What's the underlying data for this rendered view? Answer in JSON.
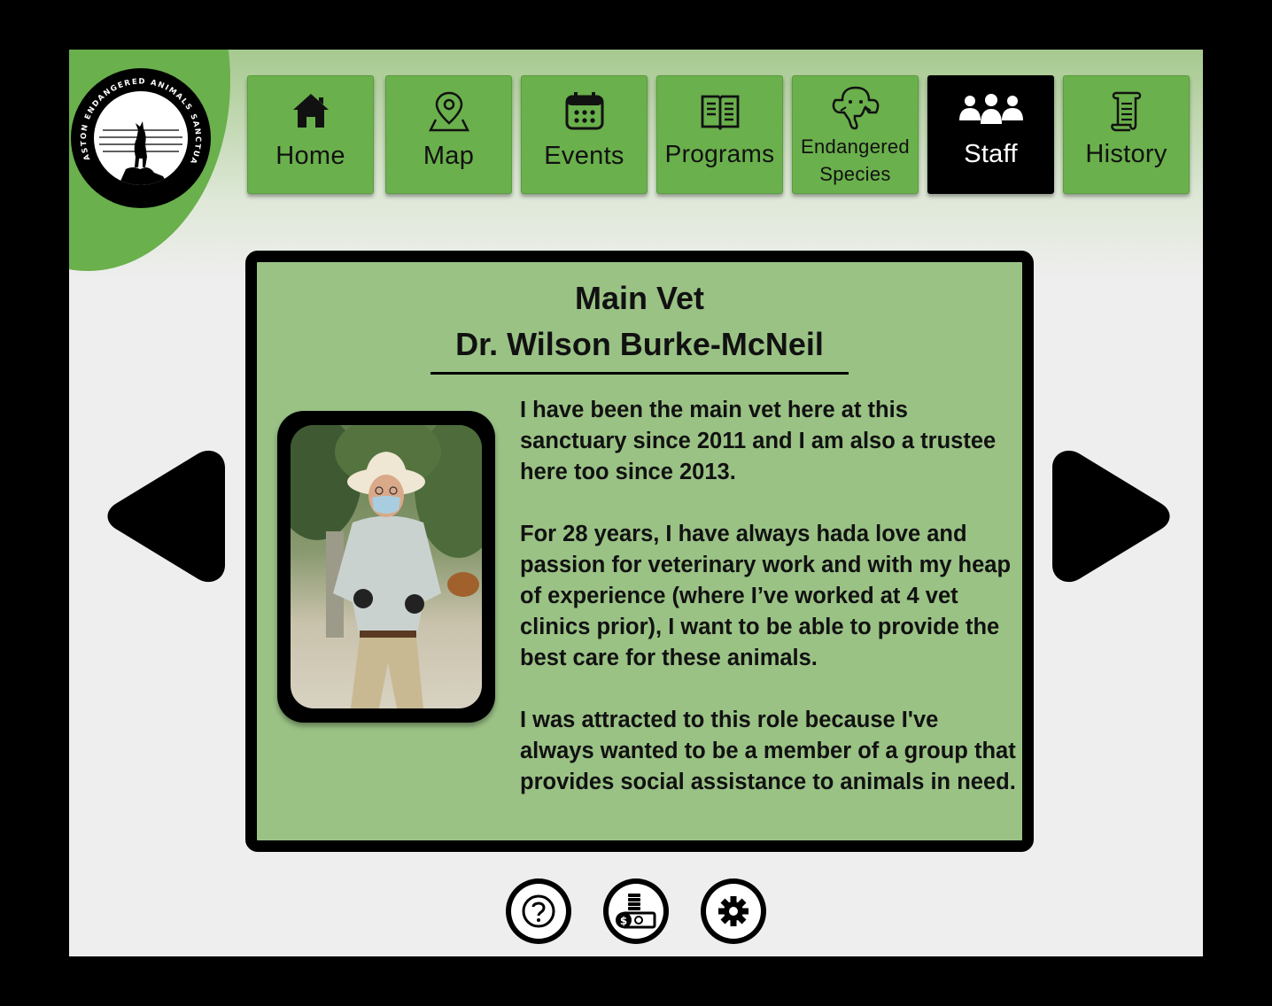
{
  "logo": {
    "text": "ASTON ENDANGERED ANIMALS SANCTUARY"
  },
  "nav": [
    {
      "label": "Home",
      "icon": "home-icon"
    },
    {
      "label": "Map",
      "icon": "map-pin-icon"
    },
    {
      "label": "Events",
      "icon": "calendar-icon"
    },
    {
      "label": "Programs",
      "icon": "book-icon"
    },
    {
      "label": "Endangered Species",
      "label_line1": "Endangered",
      "label_line2": "Species",
      "icon": "elephant-icon"
    },
    {
      "label": "Staff",
      "icon": "staff-icon",
      "active": true
    },
    {
      "label": "History",
      "icon": "scroll-icon"
    }
  ],
  "profile": {
    "role": "Main Vet",
    "name": "Dr. Wilson Burke-McNeil",
    "bio": [
      "I have been the main vet here at this sanctuary since 2011 and I am also a trustee here too since 2013.",
      "For 28 years, I have always hada love and passion for veterinary work and with my heap of experience (where I’ve worked at 4 vet clinics prior), I want to be able to provide the best care for these animals.",
      "I was attracted to this role because I've always wanted to be a member of a group that provides social assistance to animals in need."
    ]
  },
  "bottom_buttons": [
    "help-icon",
    "donate-icon",
    "settings-icon"
  ],
  "colors": {
    "accent": "#6ab04c",
    "card": "#9ac285",
    "active": "#000000"
  }
}
